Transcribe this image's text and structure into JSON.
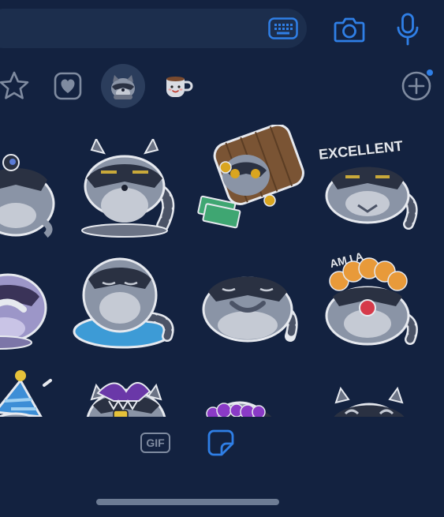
{
  "bottom_bar": {
    "gif_label": "GIF"
  },
  "stickers": [
    {
      "id": "raccoon-cry",
      "caption": ""
    },
    {
      "id": "raccoon-bored",
      "caption": ""
    },
    {
      "id": "raccoon-barrel-money",
      "caption": ""
    },
    {
      "id": "raccoon-excellent",
      "caption": "EXCELLENT"
    },
    {
      "id": "raccoon-facepalm-purple",
      "caption": ""
    },
    {
      "id": "raccoon-puddle",
      "caption": ""
    },
    {
      "id": "raccoon-laugh-cover",
      "caption": ""
    },
    {
      "id": "raccoon-clown",
      "caption": "AM I A"
    },
    {
      "id": "raccoon-party",
      "caption": ""
    },
    {
      "id": "raccoon-popcorn",
      "caption": ""
    },
    {
      "id": "raccoon-purple-bubbles",
      "caption": ""
    },
    {
      "id": "raccoon-sleepy",
      "caption": ""
    }
  ],
  "icons": {
    "keyboard": "keyboard-icon",
    "camera": "camera-icon",
    "mic": "microphone-icon",
    "star": "star-icon",
    "heart": "heart-icon",
    "raccoon_pack": "raccoon-pack-icon",
    "cup_pack": "cup-pack-icon",
    "add": "add-circle-icon",
    "sticker": "sticker-icon"
  },
  "colors": {
    "background": "#132240",
    "accent": "#2f7fe6",
    "muted": "#7f8ba0"
  }
}
